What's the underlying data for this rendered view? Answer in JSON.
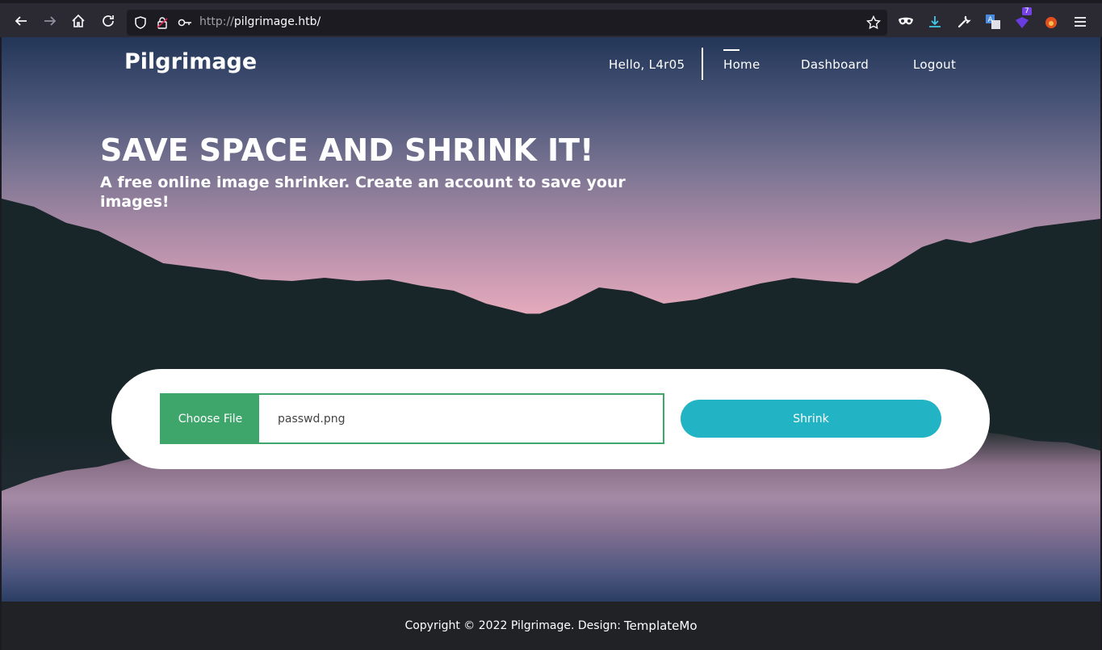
{
  "browser": {
    "url_protocol": "http://",
    "url_host": "pilgrimage.htb/",
    "extension_badge": "7"
  },
  "header": {
    "brand": "Pilgrimage",
    "greeting": "Hello, L4r05",
    "nav": [
      {
        "label": "Home",
        "active": true
      },
      {
        "label": "Dashboard",
        "active": false
      },
      {
        "label": "Logout",
        "active": false
      }
    ]
  },
  "hero": {
    "title": "SAVE SPACE AND SHRINK IT!",
    "subtitle": "A free online image shrinker. Create an account to save your images!"
  },
  "upload": {
    "choose_label": "Choose File",
    "file_name": "passwd.png",
    "submit_label": "Shrink"
  },
  "footer": {
    "text": "Copyright © 2022 Pilgrimage. Design:",
    "link": "TemplateMo"
  },
  "colors": {
    "accent_green": "#3ea56b",
    "accent_cyan": "#22b3c4",
    "footer_bg": "#212226"
  }
}
